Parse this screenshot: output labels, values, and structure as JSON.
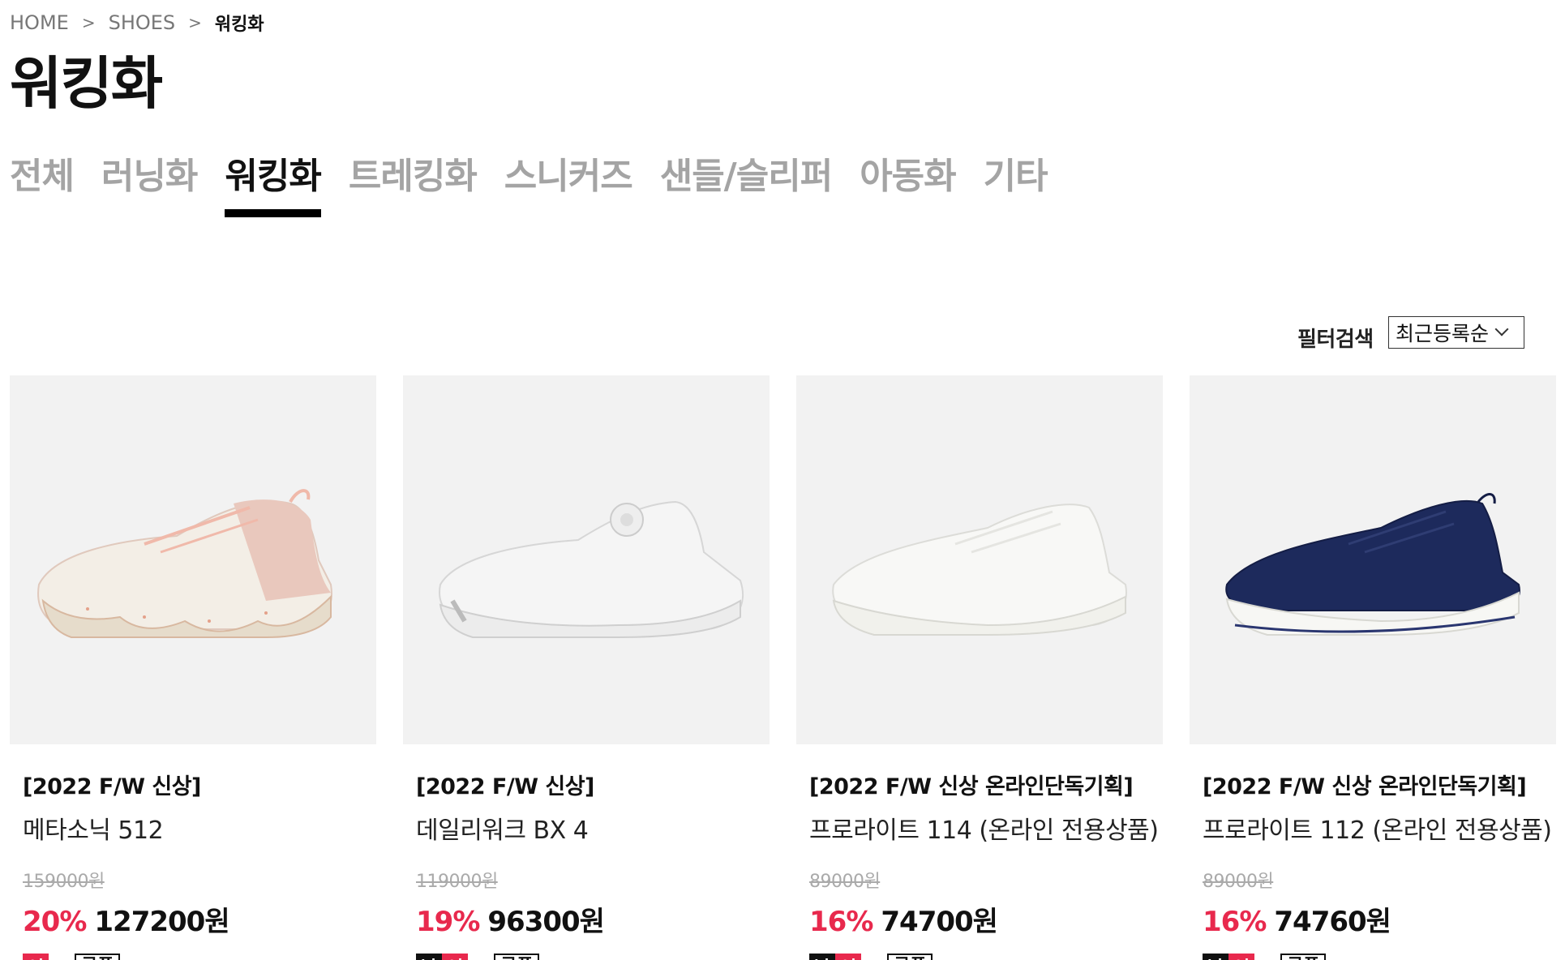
{
  "breadcrumb": {
    "home": "HOME",
    "sep": ">",
    "category": "SHOES",
    "current": "워킹화"
  },
  "page_title": "워킹화",
  "tabs": [
    {
      "label": "전체",
      "active": false
    },
    {
      "label": "러닝화",
      "active": false
    },
    {
      "label": "워킹화",
      "active": true
    },
    {
      "label": "트레킹화",
      "active": false
    },
    {
      "label": "스니커즈",
      "active": false
    },
    {
      "label": "샌들/슬리퍼",
      "active": false
    },
    {
      "label": "아동화",
      "active": false
    },
    {
      "label": "기타",
      "active": false
    }
  ],
  "filter": {
    "label": "필터검색",
    "sort_value": "최근등록순"
  },
  "products": [
    {
      "tag": "[2022 F/W 신상]",
      "name": "메타소닉 512",
      "original_price": "159000원",
      "discount": "20%",
      "price": "127200원",
      "genders": [
        "여"
      ],
      "coupon": "쿠폰"
    },
    {
      "tag": "[2022 F/W 신상]",
      "name": "데일리워크 BX 4",
      "original_price": "119000원",
      "discount": "19%",
      "price": "96300원",
      "genders": [
        "남",
        "여"
      ],
      "coupon": "쿠폰"
    },
    {
      "tag": "[2022 F/W 신상 온라인단독기획]",
      "name": "프로라이트 114 (온라인 전용상품)",
      "original_price": "89000원",
      "discount": "16%",
      "price": "74700원",
      "genders": [
        "남",
        "여"
      ],
      "coupon": "쿠폰"
    },
    {
      "tag": "[2022 F/W 신상 온라인단독기획]",
      "name": "프로라이트 112 (온라인 전용상품)",
      "original_price": "89000원",
      "discount": "16%",
      "price": "74760원",
      "genders": [
        "남",
        "여"
      ],
      "coupon": "쿠폰"
    }
  ]
}
